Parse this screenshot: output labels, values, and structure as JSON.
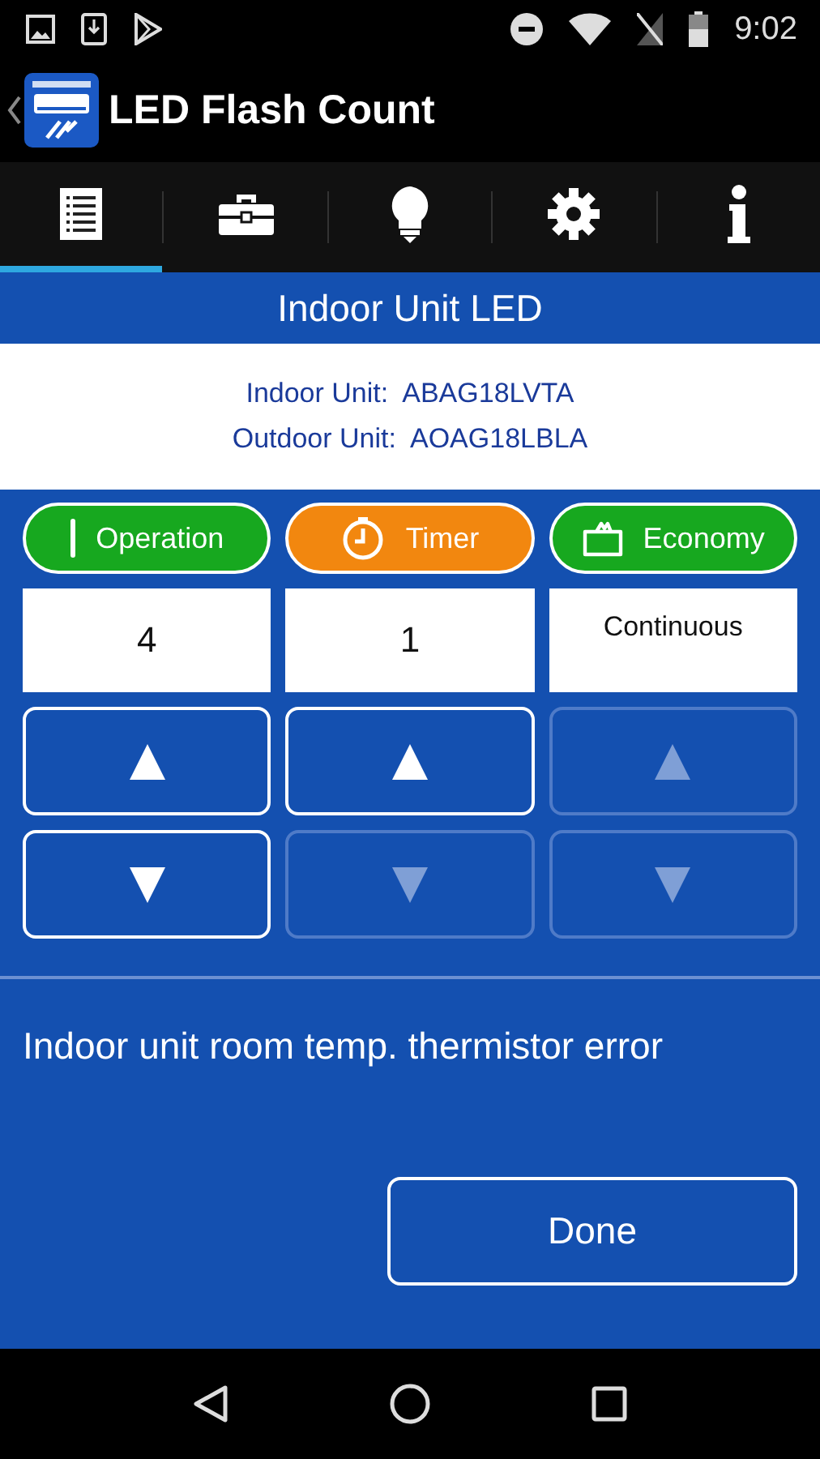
{
  "status_bar": {
    "time": "9:02"
  },
  "app_bar": {
    "title": "LED Flash Count"
  },
  "tabs": [
    {
      "kind": "list",
      "selected": true
    },
    {
      "kind": "toolbox",
      "selected": false
    },
    {
      "kind": "bulb",
      "selected": false
    },
    {
      "kind": "gear",
      "selected": false
    },
    {
      "kind": "info",
      "selected": false
    }
  ],
  "section_title": "Indoor Unit LED",
  "units": [
    {
      "label": "Indoor Unit:",
      "value": "ABAG18LVTA"
    },
    {
      "label": "Outdoor Unit:",
      "value": "AOAG18LBLA"
    }
  ],
  "columns": [
    {
      "kind": "operation",
      "label": "Operation",
      "color": "#17a81f",
      "value": "4",
      "up_disabled": false,
      "down_disabled": false
    },
    {
      "kind": "timer",
      "label": "Timer",
      "color": "#f2870f",
      "value": "1",
      "up_disabled": false,
      "down_disabled": true
    },
    {
      "kind": "economy",
      "label": "Economy",
      "color": "#17a81f",
      "value": "Continuous",
      "up_disabled": true,
      "down_disabled": true
    }
  ],
  "message": "Indoor unit room temp. thermistor error",
  "done_button": "Done"
}
